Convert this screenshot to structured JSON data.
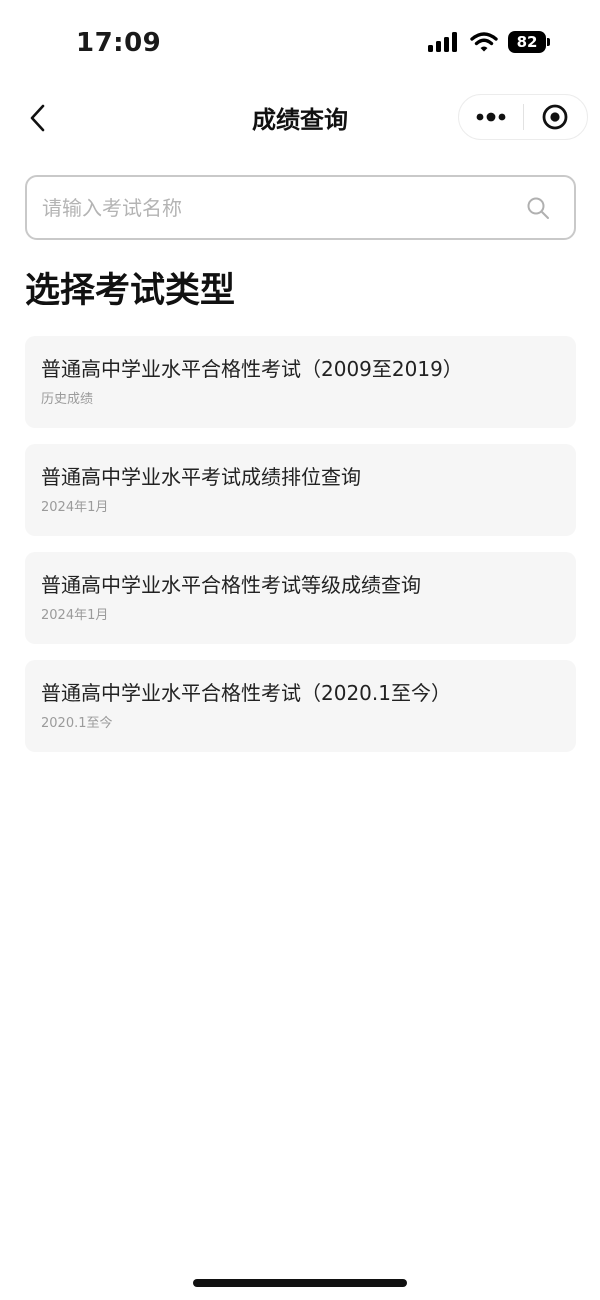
{
  "status": {
    "time": "17:09",
    "battery": "82"
  },
  "nav": {
    "title": "成绩查询"
  },
  "search": {
    "placeholder": "请输入考试名称"
  },
  "section_title": "选择考试类型",
  "exams": [
    {
      "title": "普通高中学业水平合格性考试（2009至2019）",
      "subtitle": "历史成绩"
    },
    {
      "title": "普通高中学业水平考试成绩排位查询",
      "subtitle": "2024年1月"
    },
    {
      "title": "普通高中学业水平合格性考试等级成绩查询",
      "subtitle": "2024年1月"
    },
    {
      "title": "普通高中学业水平合格性考试（2020.1至今）",
      "subtitle": "2020.1至今"
    }
  ],
  "icons": {
    "back": "chevron-left-icon",
    "more": "more-dots-icon",
    "close": "target-close-icon",
    "search": "search-icon"
  }
}
